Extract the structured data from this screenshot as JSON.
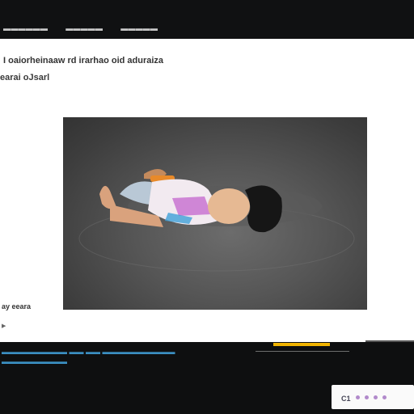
{
  "topbar": {
    "nav": [
      "▬▬▬▬▬▬",
      "▬▬▬▬▬",
      "▬▬▬▬▬"
    ]
  },
  "article": {
    "headline": "I  oaiorheinaaw rd irarhao oid aduraiza",
    "subline": "earai oJsarl"
  },
  "figure": {
    "caption": "ay eeara"
  },
  "footer": {
    "line1": "▬▬▬▬▬▬▬▬▬ ▬▬ ▬▬ ▬▬▬▬▬▬▬▬▬▬",
    "line2": "▬▬▬▬▬▬▬▬▬",
    "credit": "▬▬▬▬▬▬▬▬▬▬",
    "progress_fraction": 0.6
  },
  "widget": {
    "label": "C1"
  },
  "colors": {
    "accent": "#f1b400",
    "link": "#3b8fc2"
  }
}
